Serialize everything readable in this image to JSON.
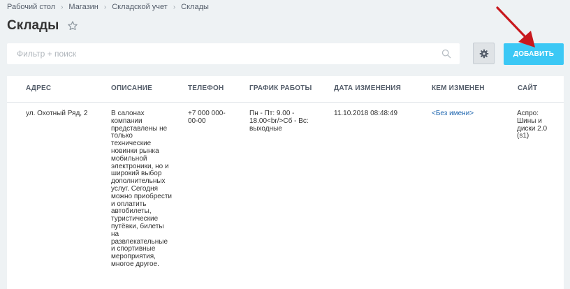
{
  "breadcrumb": [
    "Рабочий стол",
    "Магазин",
    "Складской учет",
    "Склады"
  ],
  "page": {
    "title": "Склады"
  },
  "filter": {
    "placeholder": "Фильтр + поиск"
  },
  "toolbar": {
    "add_label": "ДОБАВИТЬ"
  },
  "icons": {
    "favorite": "star-icon",
    "search": "search-icon",
    "settings": "gear-icon",
    "annotation": "red-arrow-icon"
  },
  "colors": {
    "accent": "#3bc8f5",
    "link": "#2067b0",
    "annotation": "#c8191e",
    "background": "#eef2f4"
  },
  "table": {
    "columns": [
      "АДРЕС",
      "ОПИСАНИЕ",
      "ТЕЛЕФОН",
      "ГРАФИК РАБОТЫ",
      "ДАТА ИЗМЕНЕНИЯ",
      "КЕМ ИЗМЕНЕН",
      "САЙТ"
    ],
    "rows": [
      {
        "address": "ул. Охотный Ряд, 2",
        "description": "В салонах компании представлены не только технические новинки рынка мобильной электроники, но и широкий выбор дополнительных услуг. Сегодня можно приобрести и оплатить автобилеты, туристические путёвки, билеты на развлекательные и спортивные мероприятия, многое другое.",
        "phone": "+7 000 000-00-00",
        "schedule": "Пн - Пт: 9.00 - 18.00<br/>Сб - Вс: выходные",
        "modified_date": "11.10.2018 08:48:49",
        "modified_by": "<Без имени>",
        "site": "Аспро: Шины и диски 2.0 (s1)"
      }
    ]
  }
}
